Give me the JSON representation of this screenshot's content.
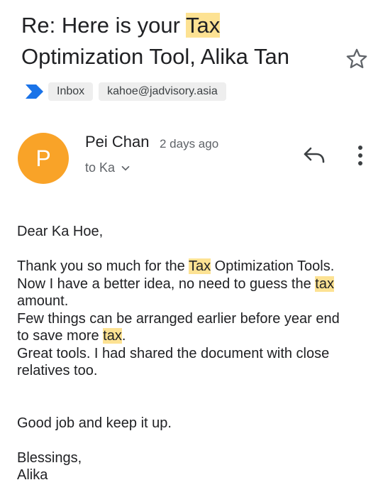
{
  "email": {
    "subject_parts": [
      {
        "text": "Re: Here is your ",
        "hl": false
      },
      {
        "text": "Tax",
        "hl": true
      },
      {
        "text": " Optimization Tool, Alika Tan",
        "hl": false
      }
    ],
    "labels": [
      "Inbox",
      "kahoe@jadvisory.asia"
    ],
    "sender": {
      "initial": "P",
      "avatar_color": "#f9a328",
      "name": "Pei Chan",
      "time": "2 days ago",
      "recipient": "to Ka"
    },
    "icons": [
      "importance-marker-icon",
      "star-icon",
      "chevron-down-icon",
      "reply-icon",
      "more-vert-icon"
    ],
    "highlight_color": "#fde293",
    "greeting": "Dear Ka Hoe,",
    "body_lines": [
      {
        "parts": [
          {
            "text": "Thank you so much for the ",
            "hl": false
          },
          {
            "text": "Tax",
            "hl": true
          },
          {
            "text": " Optimization Tools.",
            "hl": false
          }
        ]
      },
      {
        "parts": [
          {
            "text": "Now I have a better idea, no need to guess the ",
            "hl": false
          },
          {
            "text": "tax",
            "hl": true
          }
        ]
      },
      {
        "parts": [
          {
            "text": "amount.",
            "hl": false
          }
        ]
      },
      {
        "parts": [
          {
            "text": "Few things can be arranged earlier before year end",
            "hl": false
          }
        ]
      },
      {
        "parts": [
          {
            "text": "to save more ",
            "hl": false
          },
          {
            "text": "tax",
            "hl": true
          },
          {
            "text": ".",
            "hl": false
          }
        ]
      },
      {
        "parts": [
          {
            "text": "Great tools.  I had shared the document with close",
            "hl": false
          }
        ]
      },
      {
        "parts": [
          {
            "text": "relatives too.",
            "hl": false
          }
        ]
      }
    ],
    "closing": "Good job and keep it up.",
    "signoff": "Blessings,",
    "signature": "Alika"
  }
}
